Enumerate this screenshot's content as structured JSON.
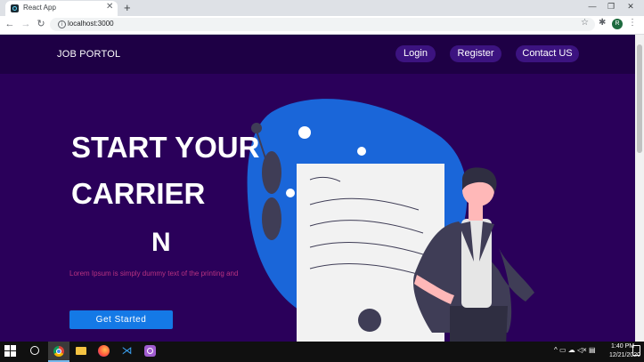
{
  "browser": {
    "tab_title": "React App",
    "url": "localhost:3000",
    "profile_initial": "R",
    "icons": {
      "close": "✕",
      "new_tab": "+",
      "back": "←",
      "forward": "→",
      "reload": "↻",
      "star": "☆",
      "extensions": "✱",
      "menu": "⋮",
      "minimize": "—",
      "maximize": "❐",
      "window_close": "✕"
    }
  },
  "site": {
    "brand": "JOB PORTOL",
    "nav": [
      {
        "label": "Login"
      },
      {
        "label": "Register"
      },
      {
        "label": "Contact US"
      }
    ],
    "hero": {
      "line1": "START YOUR",
      "line2": "CARRIER",
      "line3": "N",
      "subtitle": "Lorem Ipsum is simply dummy text of the printing and",
      "cta": "Get Started"
    },
    "colors": {
      "page_bg": "#2a005a",
      "navbar_bg": "#1e0045",
      "nav_pill": "#3c1380",
      "cta": "#1479e6",
      "subtitle": "#b83280",
      "blob": "#1a66d9"
    }
  },
  "taskbar": {
    "time": "1:40 PM",
    "date": "12/21/2020",
    "tray": "^ ▭ ☁ ◁× ▤"
  }
}
